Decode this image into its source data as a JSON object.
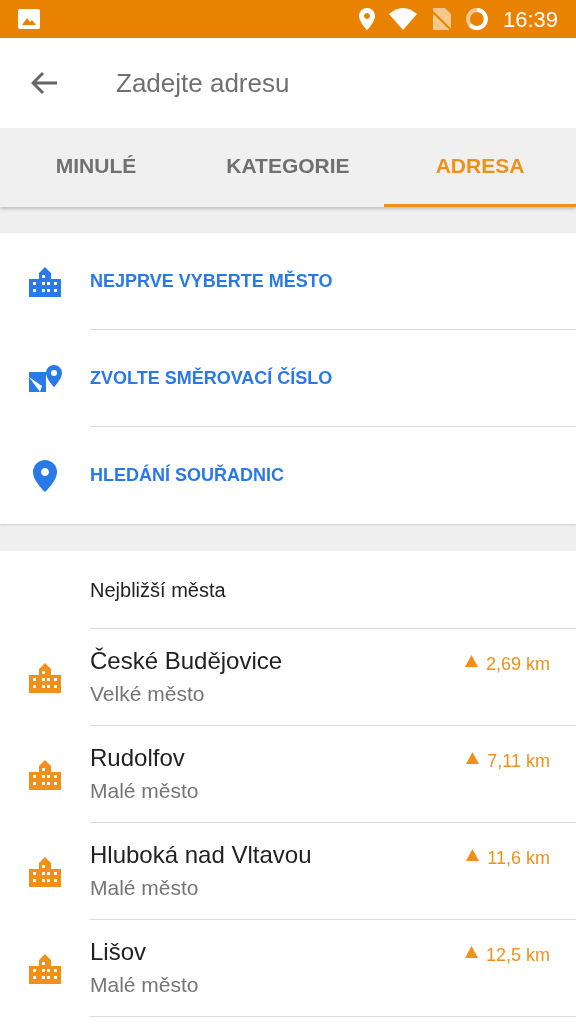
{
  "status_bar": {
    "time": "16:39"
  },
  "toolbar": {
    "title": "Zadejte adresu"
  },
  "tabs": [
    {
      "label": "MINULÉ",
      "selected": false
    },
    {
      "label": "KATEGORIE",
      "selected": false
    },
    {
      "label": "ADRESA",
      "selected": true
    }
  ],
  "options": [
    {
      "kind": "city",
      "label": "NEJPRVE VYBERTE MĚSTO"
    },
    {
      "kind": "postcode",
      "label": "ZVOLTE SMĚROVACÍ ČÍSLO"
    },
    {
      "kind": "coordinates",
      "label": "HLEDÁNÍ SOUŘADNIC"
    }
  ],
  "nearby": {
    "heading": "Nejbližší města",
    "cities": [
      {
        "name": "České Budějovice",
        "type": "Velké město",
        "distance": "2,69 km"
      },
      {
        "name": "Rudolfov",
        "type": "Malé město",
        "distance": "7,11 km"
      },
      {
        "name": "Hluboká nad Vltavou",
        "type": "Malé město",
        "distance": "11,6 km"
      },
      {
        "name": "Lišov",
        "type": "Malé město",
        "distance": "12,5 km"
      }
    ]
  }
}
